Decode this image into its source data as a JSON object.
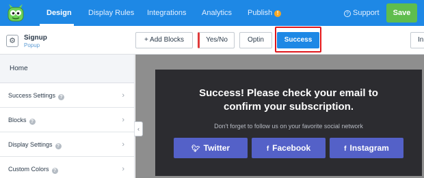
{
  "nav": {
    "items": [
      "Design",
      "Display Rules",
      "Integrations",
      "Analytics",
      "Publish"
    ],
    "publish_badge": "!",
    "support_label": "Support",
    "save_label": "Save"
  },
  "campaign": {
    "name": "Signup",
    "type": "Popup"
  },
  "toolbar": {
    "add_blocks": "+ Add Blocks",
    "views": [
      "Yes/No",
      "Optin",
      "Success"
    ],
    "cut_off_button": "In"
  },
  "sidebar": {
    "home": "Home",
    "items": [
      "Success Settings",
      "Blocks",
      "Display Settings",
      "Custom Colors"
    ]
  },
  "popup": {
    "headline_line1": "Success! Please check your email to",
    "headline_line2": "confirm your subscription.",
    "subtext": "Don't forget to follow us on your favorite social network",
    "buttons": [
      "Twitter",
      "Facebook",
      "Instagram"
    ]
  },
  "colors": {
    "nav_blue": "#1e88e5",
    "save_green": "#5fbd4d",
    "popup_bg": "#2c2c30",
    "social_button": "#5461c8",
    "highlight_red": "#e0161b"
  },
  "icons": {
    "logo": "monster-logo-icon",
    "support": "question-circle-icon",
    "campaign": "gear-icon",
    "chevron": "chevron-right-icon",
    "collapse": "chevron-left-icon",
    "twitter": "twitter-icon",
    "facebook": "facebook-icon",
    "instagram": "instagram-icon"
  }
}
